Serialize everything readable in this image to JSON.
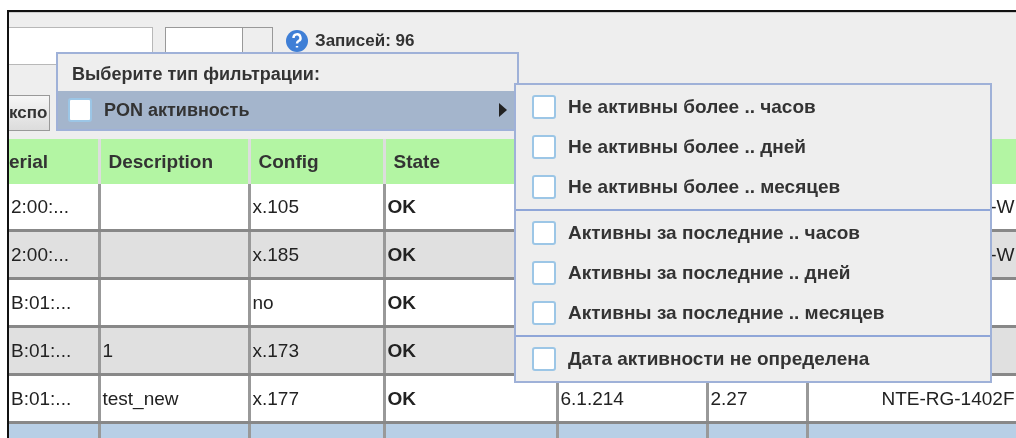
{
  "toolbar": {
    "records_label": "Записей: 96",
    "export_button": "кспо"
  },
  "table": {
    "columns": [
      "erial",
      "Description",
      "Config",
      "State",
      null,
      null,
      null
    ],
    "rows": [
      {
        "selected": false,
        "cells": [
          "2:00:...",
          null,
          "x.105",
          "OK",
          null,
          null,
          "-W"
        ]
      },
      {
        "selected": false,
        "cells": [
          "2:00:...",
          null,
          "x.185",
          "OK",
          null,
          null,
          "-W"
        ]
      },
      {
        "selected": false,
        "cells": [
          "B:01:...",
          null,
          "no",
          "OK",
          null,
          null,
          null
        ]
      },
      {
        "selected": false,
        "cells": [
          "B:01:...",
          "1",
          "x.173",
          "OK",
          null,
          null,
          null
        ]
      },
      {
        "selected": false,
        "cells": [
          "B:01:...",
          "test_new",
          "x.177",
          "OK",
          "6.1.214",
          "2.27",
          "NTE-RG-1402F"
        ]
      },
      {
        "selected": true,
        "cells": [
          null,
          null,
          null,
          null,
          null,
          null,
          null
        ]
      }
    ]
  },
  "filter_menu": {
    "title": "Выберите тип фильтрации:",
    "items": [
      {
        "label": "PON активность",
        "checked": false,
        "selected": true,
        "has_submenu": true
      }
    ],
    "submenu": {
      "groups": [
        [
          {
            "label": "Не активны более .. часов",
            "checked": false
          },
          {
            "label": "Не активны более .. дней",
            "checked": false
          },
          {
            "label": "Не активны более .. месяцев",
            "checked": false
          }
        ],
        [
          {
            "label": "Активны за последние .. часов",
            "checked": false
          },
          {
            "label": "Активны за последние .. дней",
            "checked": false
          },
          {
            "label": "Активны за последние .. месяцев",
            "checked": false
          }
        ],
        [
          {
            "label": "Дата активности не определена",
            "checked": false
          }
        ]
      ]
    }
  }
}
